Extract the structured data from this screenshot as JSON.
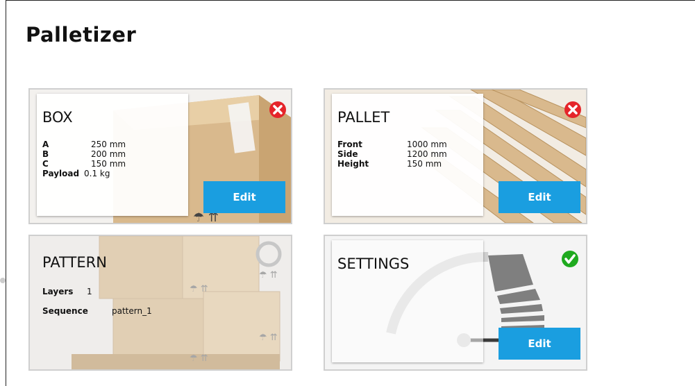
{
  "page": {
    "title": "Palletizer"
  },
  "cards": {
    "box": {
      "title": "BOX",
      "status": "error",
      "rows": [
        {
          "label": "A",
          "value": "250 mm"
        },
        {
          "label": "B",
          "value": "200 mm"
        },
        {
          "label": "C",
          "value": "150 mm"
        },
        {
          "label": "Payload",
          "value": "0.1 kg"
        }
      ],
      "edit_label": "Edit"
    },
    "pallet": {
      "title": "PALLET",
      "status": "error",
      "rows": [
        {
          "label": "Front",
          "value": "1000 mm"
        },
        {
          "label": "Side",
          "value": "1200 mm"
        },
        {
          "label": "Height",
          "value": "150 mm"
        }
      ],
      "edit_label": "Edit"
    },
    "pattern": {
      "title": "PATTERN",
      "rows": [
        {
          "label": "Layers",
          "value": "1"
        },
        {
          "label": "Sequence",
          "value": "pattern_1"
        }
      ]
    },
    "settings": {
      "title": "SETTINGS",
      "status": "ok",
      "edit_label": "Edit"
    }
  },
  "colors": {
    "accent": "#1a9ee0",
    "error": "#e5252a",
    "ok": "#1faa1f",
    "cardboard": "#d9b98d"
  }
}
